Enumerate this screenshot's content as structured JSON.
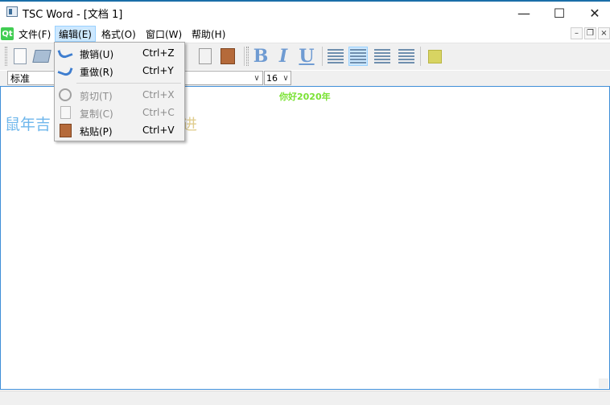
{
  "window": {
    "title": "TSC Word - [文档 1]",
    "controls": {
      "minimize": "—",
      "maximize": "☐",
      "close": "✕"
    }
  },
  "menubar": {
    "logo": "Qt",
    "items": [
      {
        "label": "文件(F)"
      },
      {
        "label": "编辑(E)",
        "active": true
      },
      {
        "label": "格式(O)"
      },
      {
        "label": "窗口(W)"
      },
      {
        "label": "帮助(H)"
      }
    ],
    "mdi_controls": {
      "minimize": "–",
      "restore": "❐",
      "close": "×"
    }
  },
  "edit_menu": {
    "items": [
      {
        "label": "撤销(U)",
        "shortcut": "Ctrl+Z",
        "enabled": true,
        "icon": "undo-icon"
      },
      {
        "label": "重做(R)",
        "shortcut": "Ctrl+Y",
        "enabled": true,
        "icon": "redo-icon"
      },
      {
        "label": "剪切(T)",
        "shortcut": "Ctrl+X",
        "enabled": false,
        "icon": "cut-icon"
      },
      {
        "label": "复制(C)",
        "shortcut": "Ctrl+C",
        "enabled": false,
        "icon": "copy-icon"
      },
      {
        "label": "粘贴(P)",
        "shortcut": "Ctrl+V",
        "enabled": true,
        "icon": "paste-icon"
      }
    ]
  },
  "toolbar": {
    "bold": "B",
    "italic": "I",
    "underline": "U",
    "alignment_active": "center",
    "color_swatch": "#d8d462",
    "icons": [
      "new-document-icon",
      "open-folder-icon",
      "copy-icon",
      "paste-icon",
      "bold-icon",
      "italic-icon",
      "underline-icon",
      "align-left-icon",
      "align-center-icon",
      "align-right-icon",
      "justify-icon",
      "text-color-icon"
    ]
  },
  "format_bar": {
    "style_value": "标准",
    "font_value": "",
    "size_value": "16",
    "dropdown_arrow": "∨"
  },
  "document": {
    "centered_text": "你好2020年",
    "main_text": "鼠年吉",
    "tail_text": "进",
    "colors": {
      "centered": "#7ae233",
      "main": "#6fb7ec",
      "tail": "#e0cd8f"
    }
  },
  "colors": {
    "accent": "#1a6ea8",
    "menu_highlight": "#cde8ff",
    "editor_border": "#3f8ed8"
  }
}
